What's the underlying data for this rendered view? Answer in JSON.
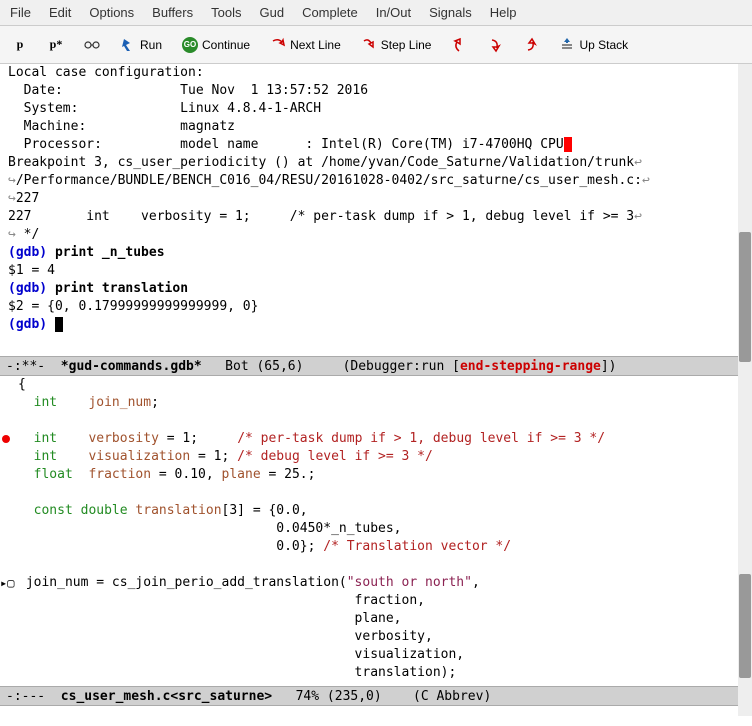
{
  "menu": {
    "items": [
      "File",
      "Edit",
      "Options",
      "Buffers",
      "Tools",
      "Gud",
      "Complete",
      "In/Out",
      "Signals",
      "Help"
    ]
  },
  "toolbar": {
    "items": [
      {
        "name": "break-icon",
        "label": "",
        "glyph": "p"
      },
      {
        "name": "break-star-icon",
        "label": "",
        "glyph": "p*"
      },
      {
        "name": "glasses-icon",
        "label": "",
        "glyph": "👓"
      },
      {
        "name": "run-icon",
        "label": "Run",
        "glyph": "🏃"
      },
      {
        "name": "continue-icon",
        "label": "Continue",
        "glyph": "GO"
      },
      {
        "name": "next-line-icon",
        "label": "Next Line",
        "glyph": "↷"
      },
      {
        "name": "step-line-icon",
        "label": "Step Line",
        "glyph": "↪"
      },
      {
        "name": "finish-icon",
        "label": "",
        "glyph": "⤴"
      },
      {
        "name": "down-icon",
        "label": "",
        "glyph": "⤵"
      },
      {
        "name": "up-icon",
        "label": "",
        "glyph": "⤴"
      },
      {
        "name": "up-stack-icon",
        "label": "Up Stack",
        "glyph": "⬆"
      }
    ]
  },
  "gud": {
    "lines": [
      {
        "t": "Local case configuration:"
      },
      {
        "t": ""
      },
      {
        "t": "  Date:               Tue Nov  1 13:57:52 2016"
      },
      {
        "t": "  System:             Linux 4.8.4-1-ARCH"
      },
      {
        "t": "  Machine:            magnatz"
      },
      {
        "t": "  Processor:          model name      : Intel(R) Core(TM) i7-4700HQ CPU",
        "redblock": true
      },
      {
        "t": "Breakpoint 3, cs_user_periodicity () at /home/yvan/Code_Saturne/Validation/trunk",
        "wrap": true
      },
      {
        "t": "/Performance/BUNDLE/BENCH_C016_04/RESU/20161028-0402/src_saturne/cs_user_mesh.c:",
        "wrap": true,
        "wraplead": true
      },
      {
        "t": "227",
        "wraplead": true
      },
      {
        "t": "227       int    verbosity = 1;     /* per-task dump if > 1, debug level if >= 3",
        "wrap": true
      },
      {
        "t": " */",
        "wraplead": true
      }
    ],
    "prompt1": {
      "p": "(gdb) ",
      "c": "print _n_tubes"
    },
    "out1": "$1 = 4",
    "prompt2": {
      "p": "(gdb) ",
      "c": "print translation"
    },
    "out2": "$2 = {0, 0.17999999999999999, 0}",
    "prompt3": {
      "p": "(gdb) "
    }
  },
  "modeline1": {
    "prefix": "-:**-  ",
    "buffer": "*gud-commands.gdb*",
    "pos": "   Bot (65,6)     (Debugger:run [",
    "status": "end-stepping-range",
    "suffix": "])"
  },
  "src": {
    "lines": [
      {
        "t": "{"
      },
      {
        "seg": [
          {
            "c": "kw",
            "t": "  int"
          },
          {
            "t": "    "
          },
          {
            "c": "var",
            "t": "join_num"
          },
          {
            "t": ";"
          }
        ]
      },
      {
        "t": ""
      },
      {
        "bp": true,
        "seg": [
          {
            "c": "kw",
            "t": "  int"
          },
          {
            "t": "    "
          },
          {
            "c": "var",
            "t": "verbosity"
          },
          {
            "t": " = 1;     "
          },
          {
            "c": "cmt",
            "t": "/* per-task dump if > 1, debug level if >= 3 */"
          }
        ]
      },
      {
        "seg": [
          {
            "c": "kw",
            "t": "  int"
          },
          {
            "t": "    "
          },
          {
            "c": "var",
            "t": "visualization"
          },
          {
            "t": " = 1; "
          },
          {
            "c": "cmt",
            "t": "/* debug level if >= 3 */"
          }
        ]
      },
      {
        "seg": [
          {
            "c": "kw",
            "t": "  float"
          },
          {
            "t": "  "
          },
          {
            "c": "var",
            "t": "fraction"
          },
          {
            "t": " = 0.10, "
          },
          {
            "c": "var",
            "t": "plane"
          },
          {
            "t": " = 25.;"
          }
        ]
      },
      {
        "t": ""
      },
      {
        "seg": [
          {
            "c": "kw",
            "t": "  const"
          },
          {
            "t": " "
          },
          {
            "c": "kw",
            "t": "double"
          },
          {
            "t": " "
          },
          {
            "c": "var",
            "t": "translation"
          },
          {
            "t": "[3] = {0.0,"
          }
        ]
      },
      {
        "t": "                                 0.0450*_n_tubes,"
      },
      {
        "seg": [
          {
            "t": "                                 0.0}; "
          },
          {
            "c": "cmt",
            "t": "/* Translation vector */"
          }
        ]
      },
      {
        "t": ""
      },
      {
        "arrow": true,
        "seg": [
          {
            "t": " join_num = cs_join_perio_add_translation("
          },
          {
            "c": "str",
            "t": "\"south or north\""
          },
          {
            "t": ","
          }
        ]
      },
      {
        "t": "                                           fraction,"
      },
      {
        "t": "                                           plane,"
      },
      {
        "t": "                                           verbosity,"
      },
      {
        "t": "                                           visualization,"
      },
      {
        "t": "                                           translation);"
      }
    ]
  },
  "modeline2": {
    "prefix": "-:---  ",
    "buffer": "cs_user_mesh.c<src_saturne>",
    "pos": "   74% (235,0)    (C Abbrev)"
  }
}
